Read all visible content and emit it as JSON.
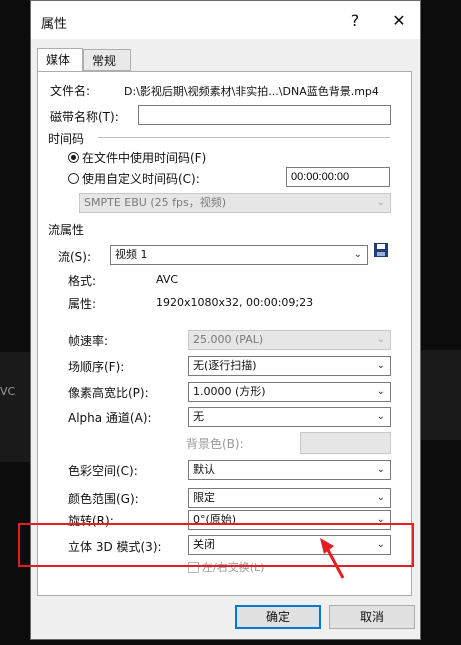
{
  "dialog": {
    "title": "属性",
    "help": "?",
    "close": "✕"
  },
  "tabs": [
    {
      "label": "媒体"
    },
    {
      "label": "常规"
    }
  ],
  "media": {
    "file_label": "文件名:",
    "file_value": "D:\\影视后期\\视频素材\\非实拍...\\DNA蓝色背景.mp4",
    "tape_label": "磁带名称(T):",
    "tape_value": "",
    "timecode_title": "时间码",
    "timecode_file": "在文件中使用时间码(F)",
    "timecode_custom": "使用自定义时间码(C):",
    "timecode_value": "00:00:00:00",
    "timecode_format": "SMPTE EBU (25 fps，视频)",
    "stream_title": "流属性",
    "stream_label": "流(S):",
    "stream_value": "视频 1",
    "format_label": "格式:",
    "format_value": "AVC",
    "attr_label": "属性:",
    "attr_value": "1920x1080x32, 00:00:09;23",
    "fps_label": "帧速率:",
    "fps_value": "25.000 (PAL)",
    "field_label": "场顺序(F):",
    "field_value": "无(逐行扫描)",
    "par_label": "像素高宽比(P):",
    "par_value": "1.0000 (方形)",
    "alpha_label": "Alpha 通道(A):",
    "alpha_value": "无",
    "bgcolor_label": "背景色(B):",
    "colorspace_label": "色彩空间(C):",
    "colorspace_value": "默认",
    "range_label": "颜色范围(G):",
    "range_value": "限定",
    "rotate_label": "旋转(R):",
    "rotate_value": "0°(原始)",
    "stereo_label": "立体 3D 模式(3):",
    "stereo_value": "关闭",
    "swap_label": "左/右交换(L)"
  },
  "buttons": {
    "ok": "确定",
    "cancel": "取消"
  },
  "background": {
    "left_text": "VC"
  },
  "colors": {
    "highlight": "#e02020",
    "arrow": "#e02020",
    "accent": "#0078d7"
  }
}
